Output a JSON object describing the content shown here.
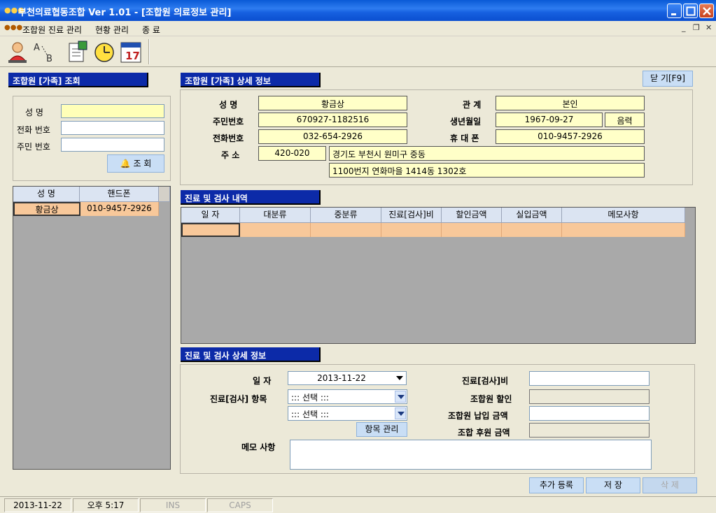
{
  "window": {
    "title": "부천의료협동조합  Ver 1.01 - [조합원 의료정보 관리]"
  },
  "menu": {
    "items": [
      "조합원 진료 관리",
      "현황 관리",
      "종 료"
    ]
  },
  "toolbar": {
    "icons": [
      "member-card-icon",
      "sort-ab-icon",
      "document-icon",
      "clock-icon",
      "calendar-icon"
    ]
  },
  "search": {
    "title": "조합원 [가족] 조회",
    "name_label": "성  명",
    "phone_label": "전화 번호",
    "ssn_label": "주민 번호",
    "name_value": "",
    "phone_value": "",
    "ssn_value": "",
    "search_button": "조 회",
    "list_headers": [
      "성 명",
      "핸드폰"
    ],
    "list_rows": [
      {
        "name": "황금상",
        "mobile": "010-9457-2926"
      }
    ]
  },
  "detail": {
    "title": "조합원 [가족] 상세 정보",
    "close_button": "닫 기[F9]",
    "name_label": "성  명",
    "name_value": "황금상",
    "relation_label": "관  계",
    "relation_value": "본인",
    "ssn_label": "주민번호",
    "ssn_value": "670927-1182516",
    "birth_label": "생년월일",
    "birth_value": "1967-09-27",
    "calendar_type": "음력",
    "phone_label": "전화번호",
    "phone_value": "032-654-2926",
    "mobile_label": "휴 대 폰",
    "mobile_value": "010-9457-2926",
    "address_label": "주  소",
    "zip_value": "420-020",
    "address1": "경기도 부천시 원미구 중동",
    "address2": "1100번지 연화마을 1414동 1302호"
  },
  "history": {
    "title": "진료 및 검사 내역",
    "headers": [
      "일 자",
      "대분류",
      "중분류",
      "진료[검사]비",
      "할인금액",
      "실입금액",
      "메모사항"
    ]
  },
  "record": {
    "title": "진료 및 검사 상세 정보",
    "date_label": "일  자",
    "date_value": "2013-11-22",
    "item_label": "진료[검사] 항목",
    "item1": "::: 선택 :::",
    "item2": "::: 선택 :::",
    "manage_button": "항목 관리",
    "fee_label": "진료[검사]비",
    "discount_label": "조합원 할인",
    "paid_label": "조합원 납입 금액",
    "support_label": "조합 후원 금액",
    "memo_label": "메모 사항"
  },
  "actions": {
    "add": "추가 등록",
    "save": "저  장",
    "delete": "삭  제"
  },
  "status": {
    "date": "2013-11-22",
    "time": "오후 5:17",
    "ins": "INS",
    "caps": "CAPS"
  }
}
